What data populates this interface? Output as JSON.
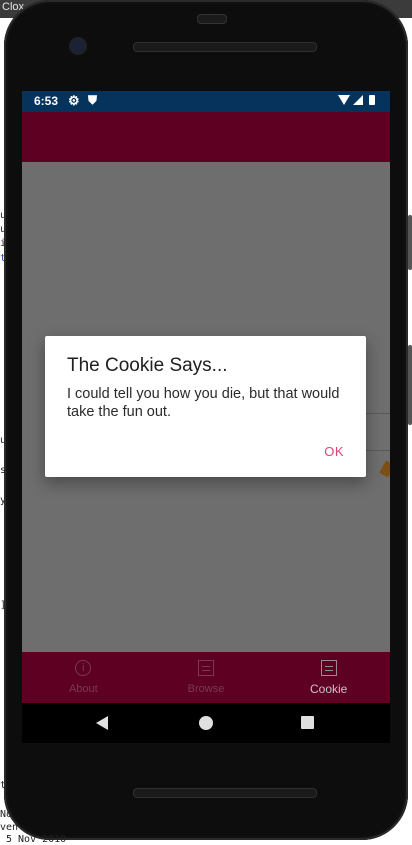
{
  "background": {
    "window_title_fragment": "Clox",
    "left_fragments": [
      "u",
      "u",
      "i",
      "t"
    ],
    "left_fragments_mid": [
      "u",
      "s",
      "y"
    ],
    "left_fragments_low": [
      "]"
    ],
    "bottom_lines": [
      "t",
      "No",
      "ven",
      "5 Nov 2010"
    ]
  },
  "status_bar": {
    "time": "6:53"
  },
  "dialog": {
    "title": "The Cookie Says...",
    "message": "I could tell you how you die, but that would take the fun out.",
    "ok_label": "OK"
  },
  "tabs": [
    {
      "label": "About",
      "active": false
    },
    {
      "label": "Browse",
      "active": false
    },
    {
      "label": "Cookie",
      "active": true
    }
  ],
  "colors": {
    "status_bar": "#05335b",
    "app_bar": "#5e0022",
    "accent": "#e0407a"
  }
}
